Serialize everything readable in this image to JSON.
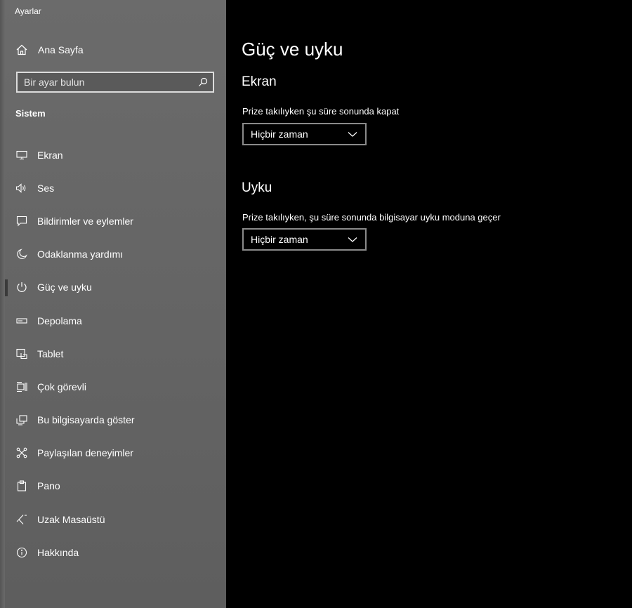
{
  "app": {
    "title": "Ayarlar"
  },
  "sidebar": {
    "home_label": "Ana Sayfa",
    "search_placeholder": "Bir ayar bulun",
    "section_label": "Sistem",
    "items": [
      {
        "label": "Ekran",
        "icon": "monitor-icon"
      },
      {
        "label": "Ses",
        "icon": "speaker-icon"
      },
      {
        "label": "Bildirimler ve eylemler",
        "icon": "notification-icon"
      },
      {
        "label": "Odaklanma yardımı",
        "icon": "moon-icon"
      },
      {
        "label": "Güç ve uyku",
        "icon": "power-icon",
        "active": true
      },
      {
        "label": "Depolama",
        "icon": "storage-icon"
      },
      {
        "label": "Tablet",
        "icon": "tablet-icon"
      },
      {
        "label": "Çok görevli",
        "icon": "multitask-icon"
      },
      {
        "label": "Bu bilgisayarda göster",
        "icon": "project-icon"
      },
      {
        "label": "Paylaşılan deneyimler",
        "icon": "shared-icon"
      },
      {
        "label": "Pano",
        "icon": "clipboard-icon"
      },
      {
        "label": "Uzak Masaüstü",
        "icon": "remote-desktop-icon"
      },
      {
        "label": "Hakkında",
        "icon": "info-icon"
      }
    ]
  },
  "main": {
    "title": "Güç ve uyku",
    "screen": {
      "heading": "Ekran",
      "description": "Prize takılıyken şu süre sonunda kapat",
      "value": "Hiçbir zaman"
    },
    "sleep": {
      "heading": "Uyku",
      "description": "Prize takılıyken, şu süre sonunda bilgisayar uyku moduna geçer",
      "value": "Hiçbir zaman"
    }
  },
  "colors": {
    "sidebar_bg": "#666666",
    "content_bg": "#000000",
    "text": "#ffffff"
  }
}
